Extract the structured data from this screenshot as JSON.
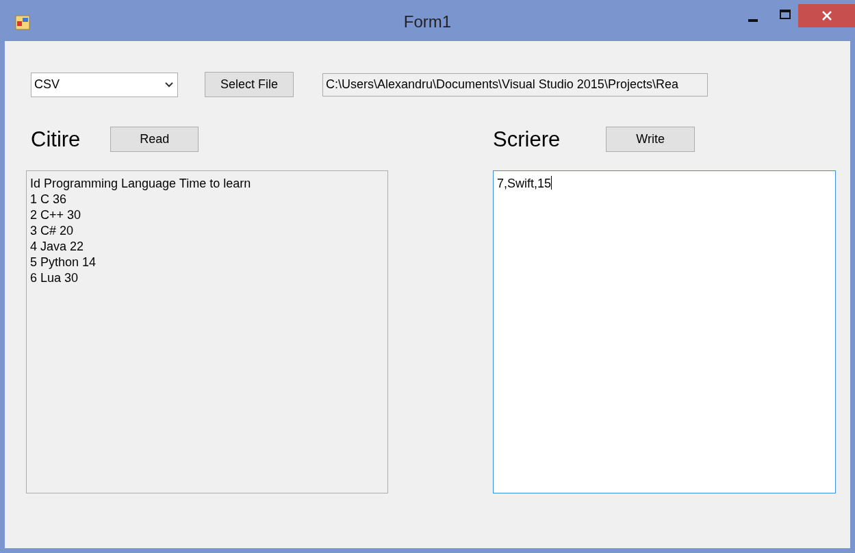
{
  "window": {
    "title": "Form1"
  },
  "format_dropdown": {
    "value": "CSV"
  },
  "select_file_button": "Select File",
  "path_field": {
    "value": "C:\\Users\\Alexandru\\Documents\\Visual Studio 2015\\Projects\\Rea"
  },
  "read_section": {
    "heading": "Citire",
    "button": "Read",
    "focused": false,
    "lines": [
      "Id Programming Language Time to learn",
      "1 C 36",
      "2 C++ 30",
      "3 C# 20",
      "4 Java 22",
      "5 Python 14",
      "6 Lua 30"
    ]
  },
  "write_section": {
    "heading": "Scriere",
    "button": "Write",
    "focused": true,
    "lines": [
      "7,Swift,15"
    ]
  }
}
